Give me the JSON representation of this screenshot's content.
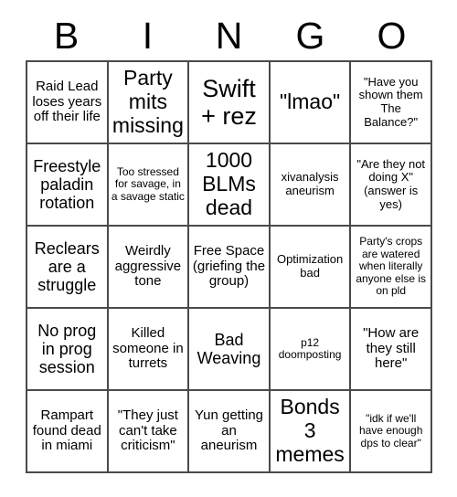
{
  "card": {
    "title_letters": [
      "B",
      "I",
      "N",
      "G",
      "O"
    ],
    "columns": 5,
    "rows": 5,
    "border_color": "#4a4a4a",
    "background_color": "#ffffff",
    "text_color": "#000000",
    "free_space_index": 12,
    "cells": [
      {
        "text": "Raid Lead loses years off their life",
        "size": "sm"
      },
      {
        "text": "Party mits missing",
        "size": "lg"
      },
      {
        "text": "Swift + rez",
        "size": "xl"
      },
      {
        "text": "\"lmao\"",
        "size": "lg"
      },
      {
        "text": "\"Have you shown them The Balance?\"",
        "size": "xs"
      },
      {
        "text": "Freestyle paladin rotation",
        "size": "md"
      },
      {
        "text": "Too stressed for savage, in a savage static",
        "size": "xxs"
      },
      {
        "text": "1000 BLMs dead",
        "size": "lg"
      },
      {
        "text": "xivanalysis aneurism",
        "size": "xs"
      },
      {
        "text": "\"Are they not doing X\" (answer is yes)",
        "size": "xs"
      },
      {
        "text": "Reclears are a struggle",
        "size": "md"
      },
      {
        "text": "Weirdly aggressive tone",
        "size": "sm"
      },
      {
        "text": "Free Space (griefing the group)",
        "size": "sm"
      },
      {
        "text": "Optimization bad",
        "size": "xs"
      },
      {
        "text": "Party's crops are watered when literally anyone else is on pld",
        "size": "xxs"
      },
      {
        "text": "No prog in prog session",
        "size": "md"
      },
      {
        "text": "Killed someone in turrets",
        "size": "sm"
      },
      {
        "text": "Bad Weaving",
        "size": "md"
      },
      {
        "text": "p12 doomposting",
        "size": "xxs"
      },
      {
        "text": "\"How are they still here\"",
        "size": "sm"
      },
      {
        "text": "Rampart found dead in miami",
        "size": "sm"
      },
      {
        "text": "\"They just can't take criticism\"",
        "size": "sm"
      },
      {
        "text": "Yun getting an aneurism",
        "size": "sm"
      },
      {
        "text": "Bonds 3 memes",
        "size": "lg"
      },
      {
        "text": "\"idk if we'll have enough dps to clear\"",
        "size": "xxs"
      }
    ]
  }
}
